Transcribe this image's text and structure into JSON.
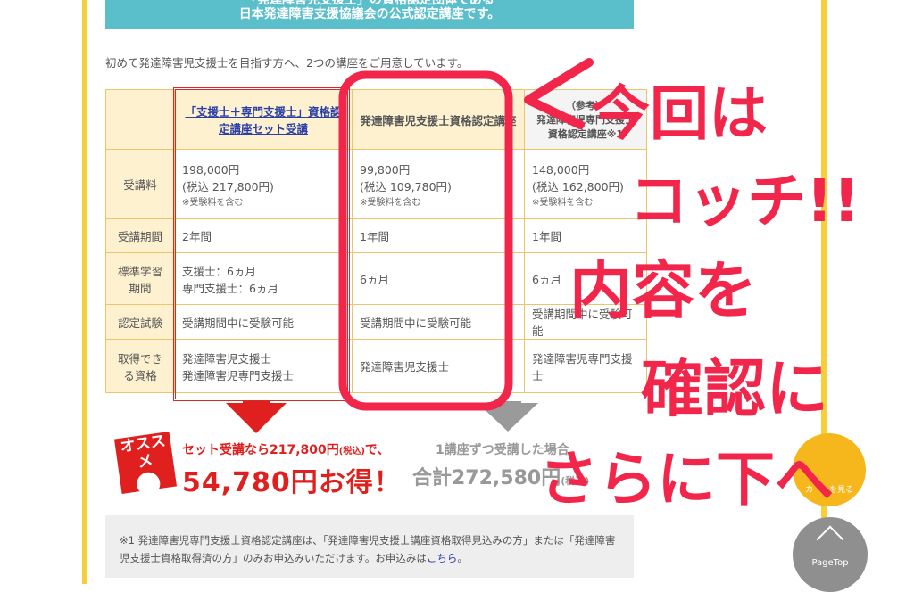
{
  "banner": {
    "line1": "「発達障害児支援士」の資格認定団体である",
    "line2": "日本発達障害支援協議会の公式認定講座です。"
  },
  "intro": "初めて発達障害児支援士を目指す方へ、2つの講座をご用意しています。",
  "table": {
    "headers": {
      "col1": "「支援士＋専門支援士」資格認定講座セット受講",
      "col2": "発達障害児支援士資格認定講座",
      "col3_prefix": "（参考）",
      "col3": "発達障害児専門支援士資格認定講座※1"
    },
    "rows": [
      {
        "label": "受講料",
        "c1": "198,000円",
        "c1b": "(税込 217,800円)",
        "c1n": "※受験料を含む",
        "c2": "99,800円",
        "c2b": "(税込 109,780円)",
        "c2n": "※受験料を含む",
        "c3": "148,000円",
        "c3b": "(税込 162,800円)",
        "c3n": "※受験料を含む"
      },
      {
        "label": "受講期間",
        "c1": "2年間",
        "c2": "1年間",
        "c3": "1年間"
      },
      {
        "label": "標準学習期間",
        "c1": "支援士：6ヵ月",
        "c1b": "専門支援士：6ヵ月",
        "c2": "6ヵ月",
        "c3": "6ヵ月"
      },
      {
        "label": "認定試験",
        "c1": "受講期間中に受験可能",
        "c2": "受講期間中に受験可能",
        "c3": "受講期間中に受験可能"
      },
      {
        "label": "取得できる資格",
        "c1": "発達障害児支援士",
        "c1b": "発達障害児専門支援士",
        "c2": "発達障害児支援士",
        "c3": "発達障害児専門支援士"
      }
    ]
  },
  "promo": {
    "badge": "オススメ",
    "line1": "セット受講なら217,800円",
    "tax": "(税込)",
    "line1_end": "で、",
    "line2": "54,780円お得！"
  },
  "compare": {
    "line1": "1講座ずつ受講した場合",
    "line2": "合計272,580円",
    "tax": "(税込)"
  },
  "cart_button": "カートを見る",
  "note": {
    "text": "※1 発達障害児専門支援士資格認定講座は、「発達障害児支援士講座資格取得見込みの方」または「発達障害児支援士資格取得済の方」のみお申込みいただけます。お申込みは",
    "link": "こちら",
    "end": "。"
  },
  "pagetop": "PageTop",
  "annotation": {
    "line1": "今回は",
    "line2": "コッチ!!",
    "line3": "内容を",
    "line4": "確認に",
    "line5": "さらに下へ",
    "color": "#f2264b"
  }
}
